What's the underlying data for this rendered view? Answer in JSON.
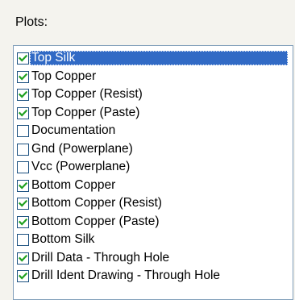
{
  "group": {
    "label": "Plots:"
  },
  "plots": {
    "items": [
      {
        "label": "Top Silk",
        "checked": true,
        "selected": true
      },
      {
        "label": "Top Copper",
        "checked": true,
        "selected": false
      },
      {
        "label": "Top Copper (Resist)",
        "checked": true,
        "selected": false
      },
      {
        "label": "Top Copper (Paste)",
        "checked": true,
        "selected": false
      },
      {
        "label": "Documentation",
        "checked": false,
        "selected": false
      },
      {
        "label": "Gnd (Powerplane)",
        "checked": false,
        "selected": false
      },
      {
        "label": "Vcc (Powerplane)",
        "checked": false,
        "selected": false
      },
      {
        "label": "Bottom Copper",
        "checked": true,
        "selected": false
      },
      {
        "label": "Bottom Copper (Resist)",
        "checked": true,
        "selected": false
      },
      {
        "label": "Bottom Copper (Paste)",
        "checked": true,
        "selected": false
      },
      {
        "label": "Bottom Silk",
        "checked": false,
        "selected": false
      },
      {
        "label": "Drill Data - Through Hole",
        "checked": true,
        "selected": false
      },
      {
        "label": "Drill Ident Drawing - Through Hole",
        "checked": true,
        "selected": false
      }
    ]
  },
  "colors": {
    "checkmark": "#21a121",
    "selection": "#316ac5",
    "checkbox_border": "#1c5180"
  }
}
